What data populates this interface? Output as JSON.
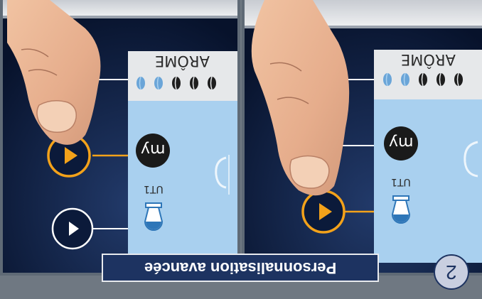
{
  "caption": {
    "text": "Personnalisation avancée"
  },
  "step": {
    "number": "2"
  },
  "panels": [
    {
      "aroma_label": "ARÔME",
      "utility_label": "UT1",
      "my_label": "my",
      "aroma_level": {
        "filled": 3,
        "total": 5
      }
    },
    {
      "aroma_label": "ARÔME",
      "utility_label": "UT1",
      "my_label": "my",
      "aroma_level": {
        "filled": 3,
        "total": 5
      }
    }
  ],
  "colors": {
    "frame": "#6f7882",
    "screen_dark": "#0b1a3a",
    "lcd_blue": "#a9d0ef",
    "lcd_header": "#e6e8ea",
    "accent_orange": "#f3a21a",
    "caption_bg": "#1d3361",
    "step_badge": "#c9cfe0",
    "bean_dark": "#1e1e1e",
    "bean_light": "#6aa5d8"
  },
  "icons": [
    "play-icon",
    "coffee-bean-icon",
    "cup-icon",
    "my-button-icon",
    "finger-icon"
  ]
}
